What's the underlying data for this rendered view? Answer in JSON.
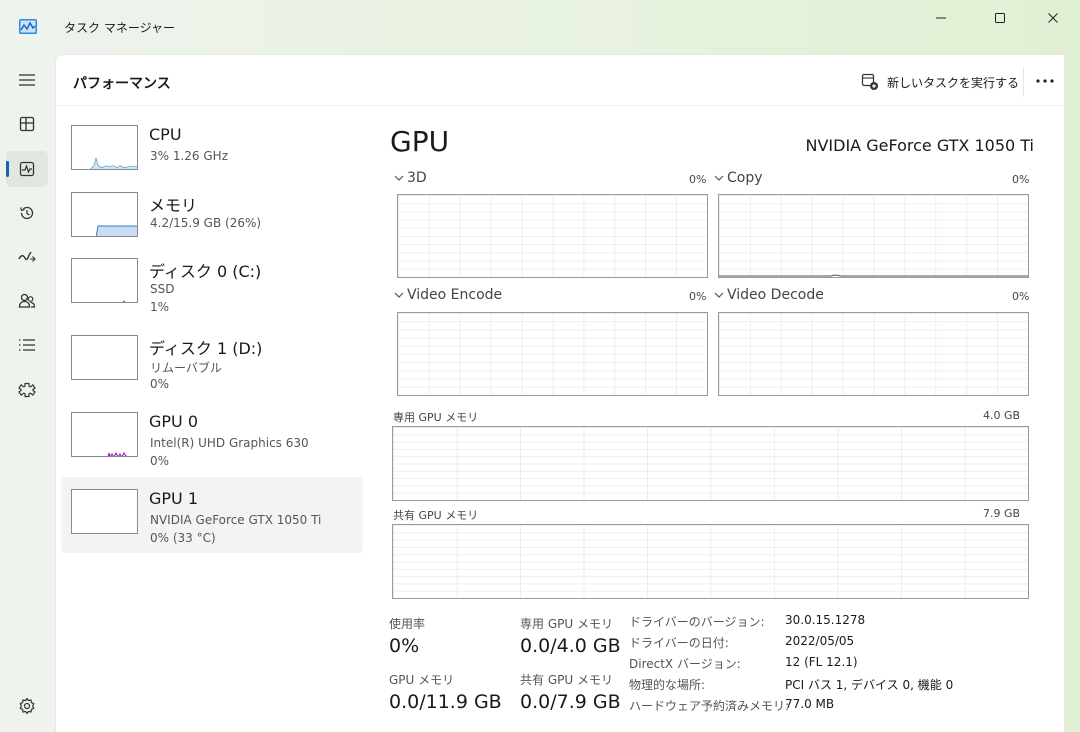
{
  "window": {
    "title": "タスク マネージャー"
  },
  "header": {
    "title": "パフォーマンス",
    "run_new_task": "新しいタスクを実行する"
  },
  "sidebar": [
    {
      "name": "CPU",
      "line1": "3%  1.26 GHz",
      "line2": ""
    },
    {
      "name": "メモリ",
      "line1": "4.2/15.9 GB (26%)",
      "line2": ""
    },
    {
      "name": "ディスク 0 (C:)",
      "line1": "SSD",
      "line2": "1%"
    },
    {
      "name": "ディスク 1 (D:)",
      "line1": "リムーバブル",
      "line2": "0%"
    },
    {
      "name": "GPU 0",
      "line1": "Intel(R) UHD Graphics 630",
      "line2": "0%"
    },
    {
      "name": "GPU 1",
      "line1": "NVIDIA GeForce GTX 1050 Ti",
      "line2": "0% (33 °C)"
    }
  ],
  "gpu": {
    "title": "GPU",
    "model": "NVIDIA GeForce GTX 1050 Ti",
    "engines": [
      {
        "label": "3D",
        "percent": "0%"
      },
      {
        "label": "Copy",
        "percent": "0%"
      },
      {
        "label": "Video Encode",
        "percent": "0%"
      },
      {
        "label": "Video Decode",
        "percent": "0%"
      }
    ],
    "dedicated_memory": {
      "label": "専用 GPU メモリ",
      "max": "4.0 GB"
    },
    "shared_memory": {
      "label": "共有 GPU メモリ",
      "max": "7.9 GB"
    },
    "stats": {
      "utilization_label": "使用率",
      "utilization": "0%",
      "dedicated_label": "専用 GPU メモリ",
      "dedicated": "0.0/4.0 GB",
      "gpu_memory_label": "GPU メモリ",
      "gpu_memory": "0.0/11.9 GB",
      "shared_label": "共有 GPU メモリ",
      "shared": "0.0/7.9 GB"
    },
    "info": [
      {
        "key": "ドライバーのバージョン:",
        "value": "30.0.15.1278"
      },
      {
        "key": "ドライバーの日付:",
        "value": "2022/05/05"
      },
      {
        "key": "DirectX バージョン:",
        "value": "12 (FL 12.1)"
      },
      {
        "key": "物理的な場所:",
        "value": "PCI バス 1, デバイス 0, 機能 0"
      },
      {
        "key": "ハードウェア予約済みメモリ:",
        "value": "77.0 MB"
      }
    ]
  },
  "colors": {
    "accent": "#1a5fb4",
    "cpu": "#117dbb",
    "memory": "#8b12ae",
    "gpu": "#8b12ae"
  },
  "icons": [
    "task-manager-icon",
    "minimize-icon",
    "maximize-icon",
    "close-icon",
    "menu-icon",
    "processes-icon",
    "performance-icon",
    "app-history-icon",
    "startup-icon",
    "users-icon",
    "details-icon",
    "services-icon",
    "settings-icon",
    "run-task-icon",
    "more-icon"
  ]
}
